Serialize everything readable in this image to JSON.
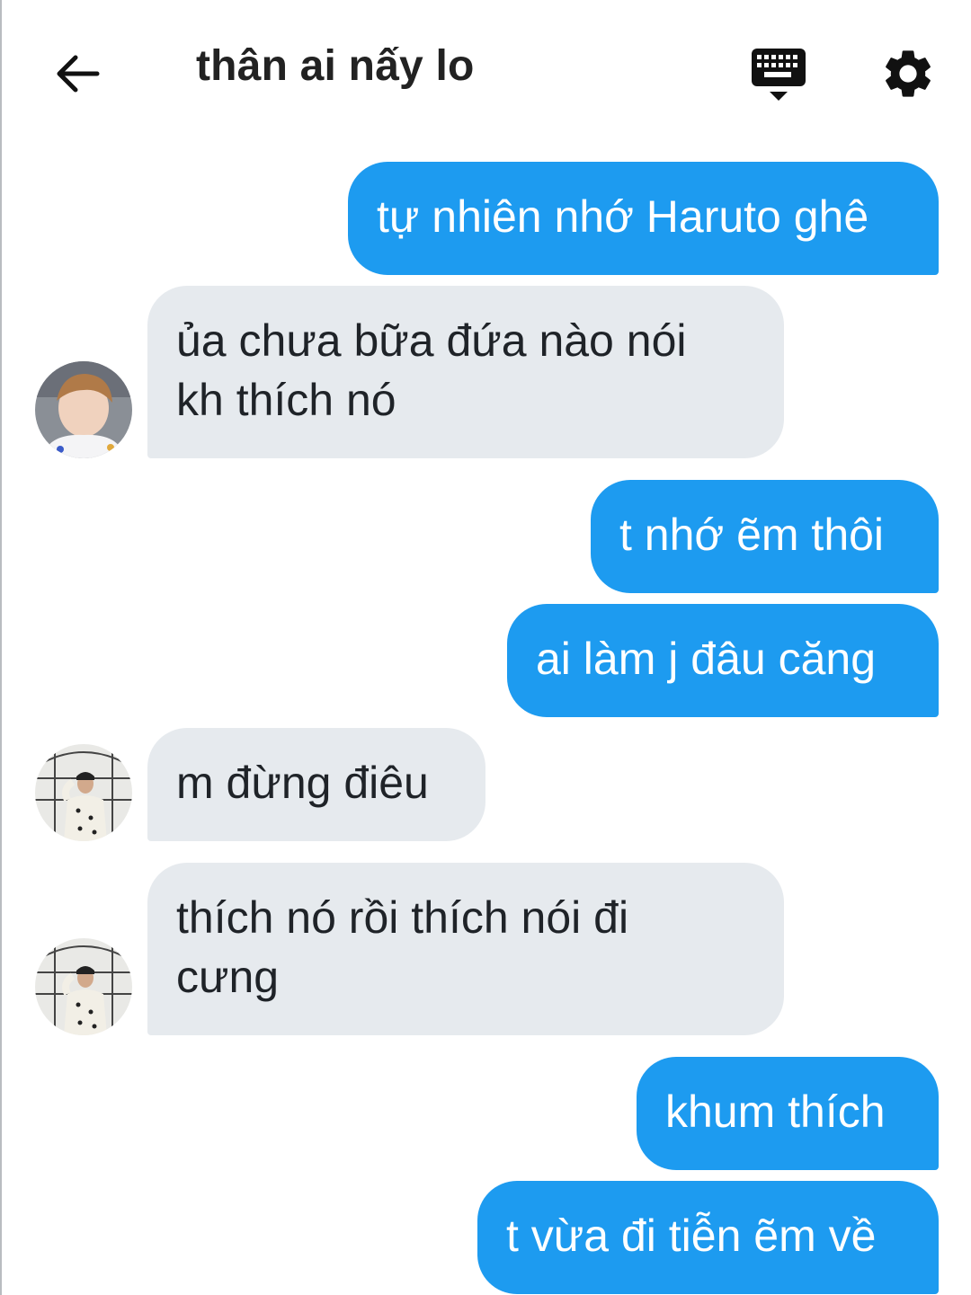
{
  "header": {
    "title": "thân ai nấy lo",
    "back_icon": "arrow-left-icon",
    "keyboard_icon": "keyboard-icon",
    "settings_icon": "gear-icon"
  },
  "colors": {
    "outgoing_bubble": "#1d9bf0",
    "incoming_bubble": "#e6eaee"
  },
  "messages": [
    {
      "direction": "outgoing",
      "lines": [
        "tự nhiên nhớ Haruto ghê"
      ]
    },
    {
      "direction": "incoming",
      "lines": [
        "ủa chưa bữa đứa nào nói",
        "kh thích nó"
      ]
    },
    {
      "direction": "outgoing",
      "lines": [
        "t nhớ ẽm thôi"
      ]
    },
    {
      "direction": "outgoing",
      "lines": [
        "ai làm j đâu căng"
      ]
    },
    {
      "direction": "incoming",
      "lines": [
        "m đừng điêu"
      ]
    },
    {
      "direction": "incoming",
      "lines": [
        "thích nó rồi thích nói đi",
        "cưng"
      ]
    },
    {
      "direction": "outgoing",
      "lines": [
        "khum thích"
      ]
    },
    {
      "direction": "outgoing",
      "lines": [
        "t vừa đi tiễn ẽm về"
      ]
    }
  ]
}
